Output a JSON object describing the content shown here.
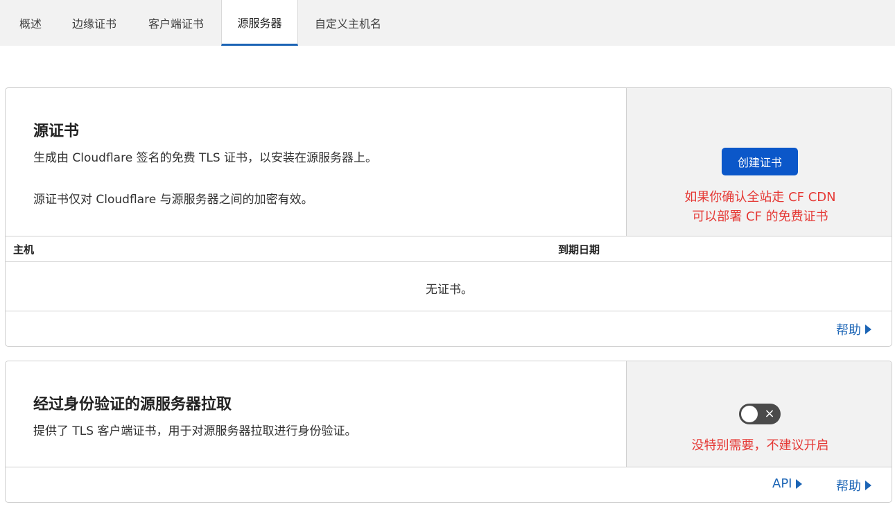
{
  "tabs": [
    {
      "label": "概述",
      "active": false
    },
    {
      "label": "边缘证书",
      "active": false
    },
    {
      "label": "客户端证书",
      "active": false
    },
    {
      "label": "源服务器",
      "active": true
    },
    {
      "label": "自定义主机名",
      "active": false
    }
  ],
  "origin_cert": {
    "title": "源证书",
    "desc1": "生成由 Cloudflare 签名的免费 TLS 证书，以安装在源服务器上。",
    "desc2": "源证书仅对 Cloudflare 与源服务器之间的加密有效。",
    "create_button": "创建证书",
    "note_line1": "如果你确认全站走 CF CDN",
    "note_line2": "可以部署 CF 的免费证书",
    "table_headers": {
      "host": "主机",
      "expiry": "到期日期"
    },
    "empty_text": "无证书。",
    "help_link": "帮助"
  },
  "auth_pull": {
    "title": "经过身份验证的源服务器拉取",
    "desc": "提供了 TLS 客户端证书，用于对源服务器拉取进行身份验证。",
    "toggle_enabled": false,
    "toggle_off_glyph": "×",
    "note": "没特别需要，不建议开启",
    "api_link": "API",
    "help_link": "帮助"
  },
  "colors": {
    "accent": "#0b57c9",
    "link": "#1b64b5",
    "note_red": "#e53935"
  }
}
